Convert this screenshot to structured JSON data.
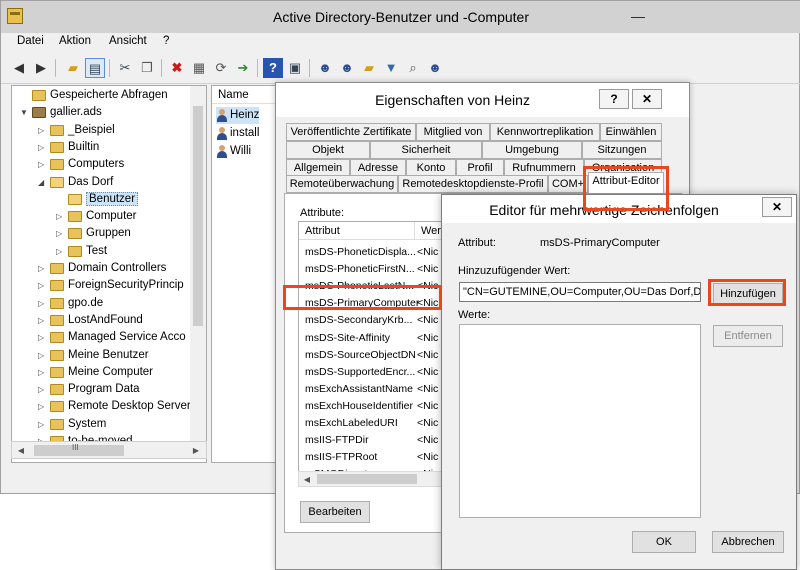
{
  "main_window": {
    "title": "Active Directory-Benutzer und -Computer",
    "controls": {
      "minimize": "—",
      "maximize": "□",
      "close": "✕"
    }
  },
  "menu": [
    "Datei",
    "Aktion",
    "Ansicht",
    "?"
  ],
  "toolbar_icons": [
    "back-arrow-icon",
    "forward-arrow-icon",
    "folder-up-icon",
    "console-tree-icon",
    "cut-icon",
    "copy-icon",
    "delete-icon",
    "properties-icon",
    "refresh-icon",
    "export-icon",
    "help-icon",
    "console-icon",
    "new-user-icon",
    "new-group-icon",
    "new-ou-icon",
    "filter-icon",
    "find-icon",
    "add-member-icon"
  ],
  "tree": {
    "items": [
      {
        "label": "Gespeicherte Abfragen",
        "indent": 0,
        "toggle": "",
        "open": false
      },
      {
        "label": "gallier.ads",
        "indent": 0,
        "toggle": "▼",
        "open": true,
        "domain": true
      },
      {
        "label": "_Beispiel",
        "indent": 1,
        "toggle": "▷",
        "open": false
      },
      {
        "label": "Builtin",
        "indent": 1,
        "toggle": "▷",
        "open": false
      },
      {
        "label": "Computers",
        "indent": 1,
        "toggle": "▷",
        "open": false
      },
      {
        "label": "Das Dorf",
        "indent": 1,
        "toggle": "◢",
        "open": true
      },
      {
        "label": "Benutzer",
        "indent": 2,
        "toggle": "",
        "open": true,
        "selected": true
      },
      {
        "label": "Computer",
        "indent": 2,
        "toggle": "▷",
        "open": false
      },
      {
        "label": "Gruppen",
        "indent": 2,
        "toggle": "▷",
        "open": false
      },
      {
        "label": "Test",
        "indent": 2,
        "toggle": "▷",
        "open": false
      },
      {
        "label": "Domain Controllers",
        "indent": 1,
        "toggle": "▷",
        "open": false
      },
      {
        "label": "ForeignSecurityPrincip",
        "indent": 1,
        "toggle": "▷",
        "open": false
      },
      {
        "label": "gpo.de",
        "indent": 1,
        "toggle": "▷",
        "open": false
      },
      {
        "label": "LostAndFound",
        "indent": 1,
        "toggle": "▷",
        "open": false
      },
      {
        "label": "Managed Service Acco",
        "indent": 1,
        "toggle": "▷",
        "open": false
      },
      {
        "label": "Meine Benutzer",
        "indent": 1,
        "toggle": "▷",
        "open": false
      },
      {
        "label": "Meine Computer",
        "indent": 1,
        "toggle": "▷",
        "open": false
      },
      {
        "label": "Program Data",
        "indent": 1,
        "toggle": "▷",
        "open": false
      },
      {
        "label": "Remote Desktop Server",
        "indent": 1,
        "toggle": "▷",
        "open": false
      },
      {
        "label": "System",
        "indent": 1,
        "toggle": "▷",
        "open": false
      },
      {
        "label": "to-be-moved",
        "indent": 1,
        "toggle": "▷",
        "open": false
      }
    ],
    "scroll_left": "◀",
    "scroll_right": "▶",
    "scroll_grip": "III"
  },
  "list": {
    "header": "Name",
    "items": [
      "Heinz",
      "install",
      "Willi"
    ]
  },
  "properties": {
    "title": "Eigenschaften von Heinz",
    "help": "?",
    "close": "✕",
    "tabs_row1": [
      "Veröffentlichte Zertifikate",
      "Mitglied von",
      "Kennwortreplikation",
      "Einwählen"
    ],
    "tabs_row2": [
      "Objekt",
      "Sicherheit",
      "Umgebung",
      "Sitzungen"
    ],
    "tabs_row3": [
      "Allgemein",
      "Adresse",
      "Konto",
      "Profil",
      "Rufnummern",
      "Organisation"
    ],
    "tabs_row4": [
      "Remoteüberwachung",
      "Remotedesktopdienste-Profil",
      "COM+",
      "Attribut-Editor"
    ],
    "attributes_label": "Attribute:",
    "col_attribute": "Attribut",
    "col_value": "Wer",
    "rows": [
      {
        "name": "msDS-PhoneticDispla...",
        "value": "<Nic"
      },
      {
        "name": "msDS-PhoneticFirstN...",
        "value": "<Nic"
      },
      {
        "name": "msDS-PhoneticLastN...",
        "value": "<Nic"
      },
      {
        "name": "msDS-PrimaryComputer",
        "value": "<Nic"
      },
      {
        "name": "msDS-SecondaryKrb...",
        "value": "<Nic"
      },
      {
        "name": "msDS-Site-Affinity",
        "value": "<Nic"
      },
      {
        "name": "msDS-SourceObjectDN",
        "value": "<Nic"
      },
      {
        "name": "msDS-SupportedEncr...",
        "value": "<Nic"
      },
      {
        "name": "msExchAssistantName",
        "value": "<Nic"
      },
      {
        "name": "msExchHouseIdentifier",
        "value": "<Nic"
      },
      {
        "name": "msExchLabeledURI",
        "value": "<Nic"
      },
      {
        "name": "msIIS-FTPDir",
        "value": "<Nic"
      },
      {
        "name": "msIIS-FTPRoot",
        "value": "<Nic"
      },
      {
        "name": "mSMQDigests",
        "value": "<Nic"
      }
    ],
    "edit_button": "Bearbeiten"
  },
  "editor": {
    "title": "Editor für mehrwertige Zeichenfolgen",
    "close": "✕",
    "attribute_label": "Attribut:",
    "attribute_value": "msDS-PrimaryComputer",
    "add_value_label": "Hinzuzufügender Wert:",
    "add_value": "\"CN=GUTEMINE,OU=Computer,OU=Das Dorf,DC=g",
    "add_button": "Hinzufügen",
    "values_label": "Werte:",
    "remove_button": "Entfernen",
    "ok_button": "OK",
    "cancel_button": "Abbrechen"
  },
  "highlight_color": "#e8481e"
}
